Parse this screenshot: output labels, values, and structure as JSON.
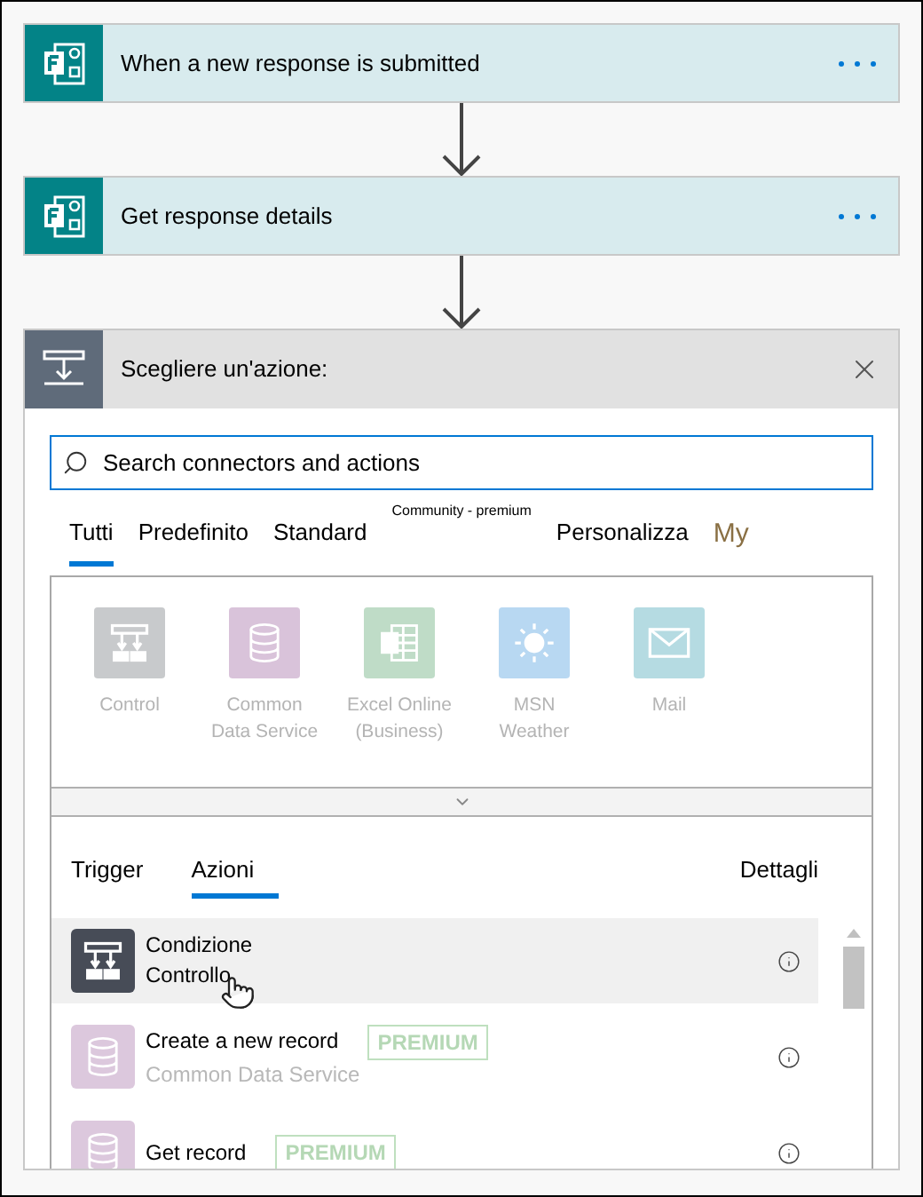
{
  "flow_steps": [
    {
      "title": "When a new response is submitted"
    },
    {
      "title": "Get response details"
    }
  ],
  "action_picker": {
    "title": "Scegliere un'azione:",
    "search": {
      "placeholder": "Search connectors and actions"
    },
    "tabs": [
      {
        "label": "Tutti",
        "selected": true,
        "kind": "normal"
      },
      {
        "label": "Predefinito",
        "selected": false,
        "kind": "normal"
      },
      {
        "label": "Standard",
        "selected": false,
        "kind": "normal"
      },
      {
        "label": "Community - premium",
        "selected": false,
        "kind": "small"
      },
      {
        "label": "Personalizza",
        "selected": false,
        "kind": "normal"
      },
      {
        "label": "My",
        "selected": false,
        "kind": "large"
      }
    ],
    "connectors": [
      {
        "name": "Control",
        "kind": "control",
        "color": "#c8cacc"
      },
      {
        "name": "Common Data Service",
        "kind": "database",
        "color": "#d9c3da"
      },
      {
        "name": "Excel Online (Business)",
        "kind": "excel",
        "color": "#bfdcc7"
      },
      {
        "name": "MSN Weather",
        "kind": "weather",
        "color": "#b8d8f2"
      },
      {
        "name": "Mail",
        "kind": "mail",
        "color": "#b5dbe2"
      }
    ],
    "subtabs": [
      {
        "label": "Trigger",
        "selected": false
      },
      {
        "label": "Azioni",
        "selected": true
      }
    ],
    "details_link": "Dettagli",
    "actions": [
      {
        "title": "Condizione",
        "subtitle": "Controllo",
        "kind": "control",
        "color": "#474c57",
        "selected": true
      },
      {
        "title": "Create a new record",
        "subtitle": "Common Data Service",
        "badge": "PREMIUM",
        "kind": "database",
        "color": "#dcc8dd",
        "selected": false
      },
      {
        "title": "Get record",
        "badge": "PREMIUM",
        "kind": "database",
        "color": "#dcc8dd",
        "selected": false
      }
    ]
  }
}
